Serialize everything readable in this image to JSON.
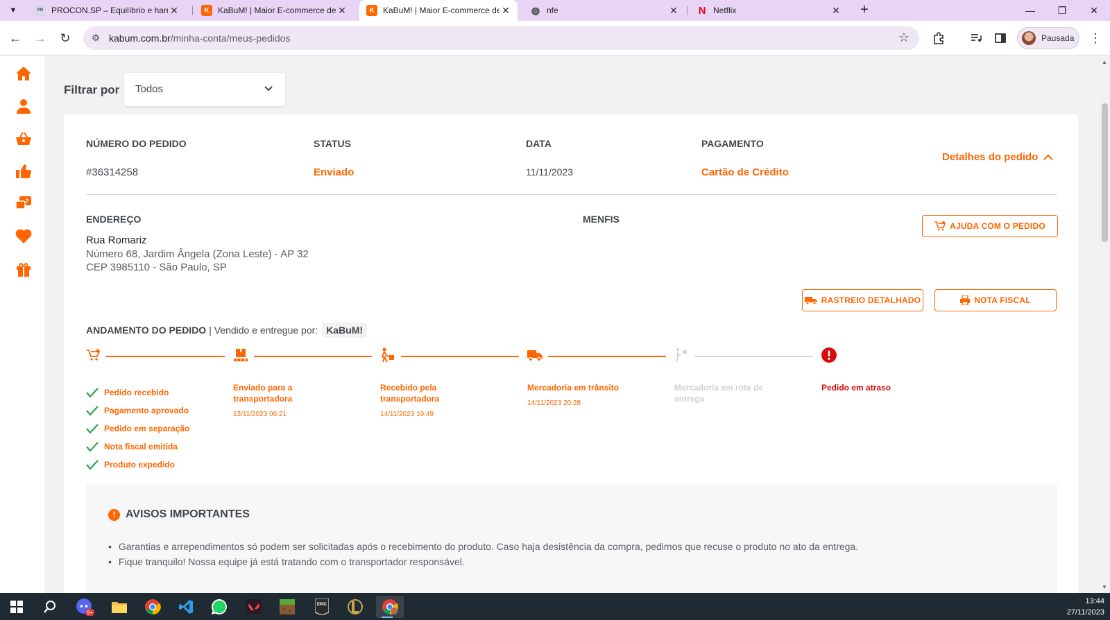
{
  "browser": {
    "tabs": [
      {
        "title": "PROCON.SP – Equilíbrio e harm",
        "active": false
      },
      {
        "title": "KaBuM! | Maior E-commerce de",
        "active": false
      },
      {
        "title": "KaBuM! | Maior E-commerce de",
        "active": true
      },
      {
        "title": "nfe",
        "active": false
      },
      {
        "title": "Netflix",
        "active": false
      }
    ],
    "url_host": "kabum.com.br",
    "url_path": "/minha-conta/meus-pedidos",
    "profile_label": "Pausada"
  },
  "filter": {
    "label": "Filtrar por",
    "selected": "Todos"
  },
  "order": {
    "headers": {
      "number": "NÚMERO DO PEDIDO",
      "status": "STATUS",
      "date": "DATA",
      "payment": "PAGAMENTO"
    },
    "number": "#36314258",
    "status": "Enviado",
    "date": "11/11/2023",
    "payment": "Cartão de Crédito",
    "details_link": "Detalhes do pedido",
    "address_header": "ENDEREÇO",
    "address_line1": "Rua Romariz",
    "address_line2": "Número 68, Jardim Ângela (Zona Leste) - AP 32",
    "address_line3": "CEP 3985110 - São Paulo, SP",
    "recipient": "MENFIS",
    "help_button": "AJUDA COM O PEDIDO",
    "tracking_button": "RASTREIO DETALHADO",
    "invoice_button": "NOTA FISCAL"
  },
  "progress": {
    "title": "ANDAMENTO DO PEDIDO",
    "sold_by_prefix": "| Vendido e entregue por:",
    "seller": "KaBuM!",
    "checks": [
      "Pedido recebido",
      "Pagamento aprovado",
      "Pedido em separação",
      "Nota fiscal emitida",
      "Produto expedido"
    ],
    "steps": [
      {
        "title": "Enviado para a transportadora",
        "date": "13/11/2023 06:21"
      },
      {
        "title": "Recebido pela transportadora",
        "date": "14/11/2023 19:49"
      },
      {
        "title": "Mercadoria em trânsito",
        "date": "14/11/2023 20:28"
      },
      {
        "title": "Mercadoria em rota de entrega",
        "date": ""
      },
      {
        "title": "Pedido em atraso",
        "date": ""
      }
    ]
  },
  "notice": {
    "title": "AVISOS IMPORTANTES",
    "items": [
      "Garantias e arrependimentos só podem ser solicitadas após o recebimento do produto. Caso haja desistência da compra, pedimos que recuse o produto no ato da entrega.",
      "Fique tranquilo! Nossa equipe já está tratando com o transportador responsável."
    ]
  },
  "taskbar": {
    "time": "13:44",
    "date": "27/11/2023",
    "discord_badge": "9+"
  },
  "colors": {
    "accent": "#ff6500",
    "alert": "#d40c0c",
    "check": "#2ea24a"
  }
}
